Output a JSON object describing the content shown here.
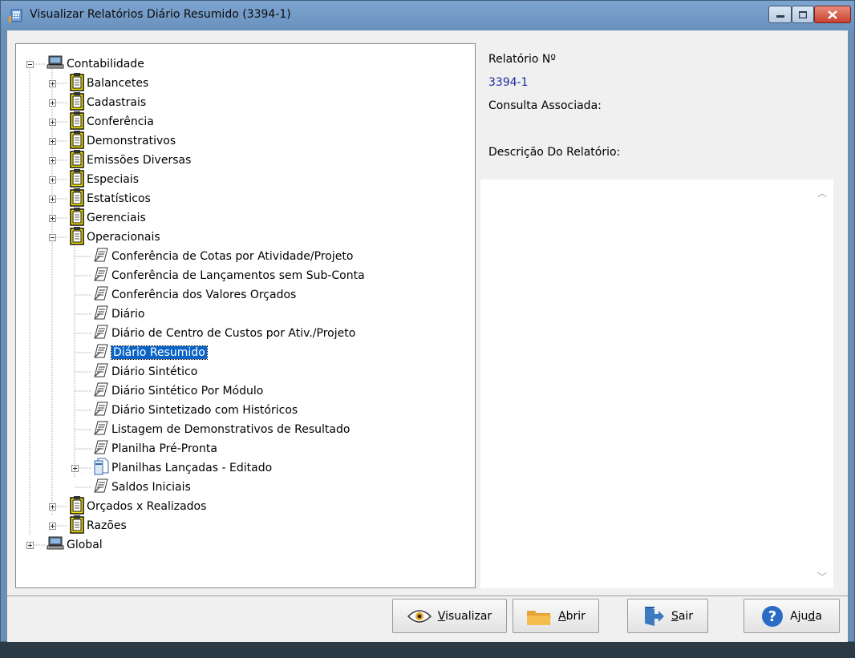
{
  "window": {
    "title": "Visualizar Relatórios Diário Resumido (3394-1)"
  },
  "tree": [
    {
      "label": "Contabilidade",
      "icon": "computer-icon",
      "level": 0,
      "expander": "minus"
    },
    {
      "label": "Balancetes",
      "icon": "clipboard-icon",
      "level": 1,
      "expander": "plus"
    },
    {
      "label": "Cadastrais",
      "icon": "clipboard-icon",
      "level": 1,
      "expander": "plus"
    },
    {
      "label": "Conferência",
      "icon": "clipboard-icon",
      "level": 1,
      "expander": "plus"
    },
    {
      "label": "Demonstrativos",
      "icon": "clipboard-icon",
      "level": 1,
      "expander": "plus"
    },
    {
      "label": "Emissões Diversas",
      "icon": "clipboard-icon",
      "level": 1,
      "expander": "plus"
    },
    {
      "label": "Especiais",
      "icon": "clipboard-icon",
      "level": 1,
      "expander": "plus"
    },
    {
      "label": "Estatísticos",
      "icon": "clipboard-icon",
      "level": 1,
      "expander": "plus"
    },
    {
      "label": "Gerenciais",
      "icon": "clipboard-icon",
      "level": 1,
      "expander": "plus"
    },
    {
      "label": "Operacionais",
      "icon": "clipboard-icon",
      "level": 1,
      "expander": "minus"
    },
    {
      "label": "Conferência de Cotas por Atividade/Projeto",
      "icon": "report-icon",
      "level": 2
    },
    {
      "label": "Conferência de Lançamentos sem Sub-Conta",
      "icon": "report-icon",
      "level": 2
    },
    {
      "label": "Conferência dos Valores Orçados",
      "icon": "report-icon",
      "level": 2
    },
    {
      "label": "Diário",
      "icon": "report-icon",
      "level": 2
    },
    {
      "label": "Diário de Centro de Custos por Ativ./Projeto",
      "icon": "report-icon",
      "level": 2
    },
    {
      "label": "Diário Resumido",
      "icon": "report-icon",
      "level": 2,
      "selected": true
    },
    {
      "label": "Diário Sintético",
      "icon": "report-icon",
      "level": 2
    },
    {
      "label": "Diário Sintético Por Módulo",
      "icon": "report-icon",
      "level": 2
    },
    {
      "label": "Diário Sintetizado com Históricos",
      "icon": "report-icon",
      "level": 2
    },
    {
      "label": "Listagem de Demonstrativos de Resultado",
      "icon": "report-icon",
      "level": 2
    },
    {
      "label": "Planilha Pré-Pronta",
      "icon": "report-icon",
      "level": 2
    },
    {
      "label": "Planilhas Lançadas - Editado",
      "icon": "document-icon",
      "level": 2,
      "expander": "plus"
    },
    {
      "label": "Saldos Iniciais",
      "icon": "report-icon",
      "level": 2
    },
    {
      "label": "Orçados x Realizados",
      "icon": "clipboard-icon",
      "level": 1,
      "expander": "plus"
    },
    {
      "label": "Razões",
      "icon": "clipboard-icon",
      "level": 1,
      "expander": "plus"
    },
    {
      "label": "Global",
      "icon": "computer-icon",
      "level": 0,
      "expander": "plus"
    }
  ],
  "details": {
    "report_no_label": "Relatório Nº",
    "report_no_value": "3394-1",
    "query_label": "Consulta Associada:",
    "description_label": "Descrição Do Relatório:"
  },
  "buttons": {
    "view_u": "V",
    "view_rest": "isualizar",
    "open_u": "A",
    "open_rest": "brir",
    "exit_u": "S",
    "exit_rest": "air",
    "help_pre": "Aju",
    "help_u": "d",
    "help_post": "a"
  },
  "colors": {
    "selection": "#0a64c8",
    "title_bar": "#7ea4cf",
    "report_number": "#1d2b9e"
  }
}
